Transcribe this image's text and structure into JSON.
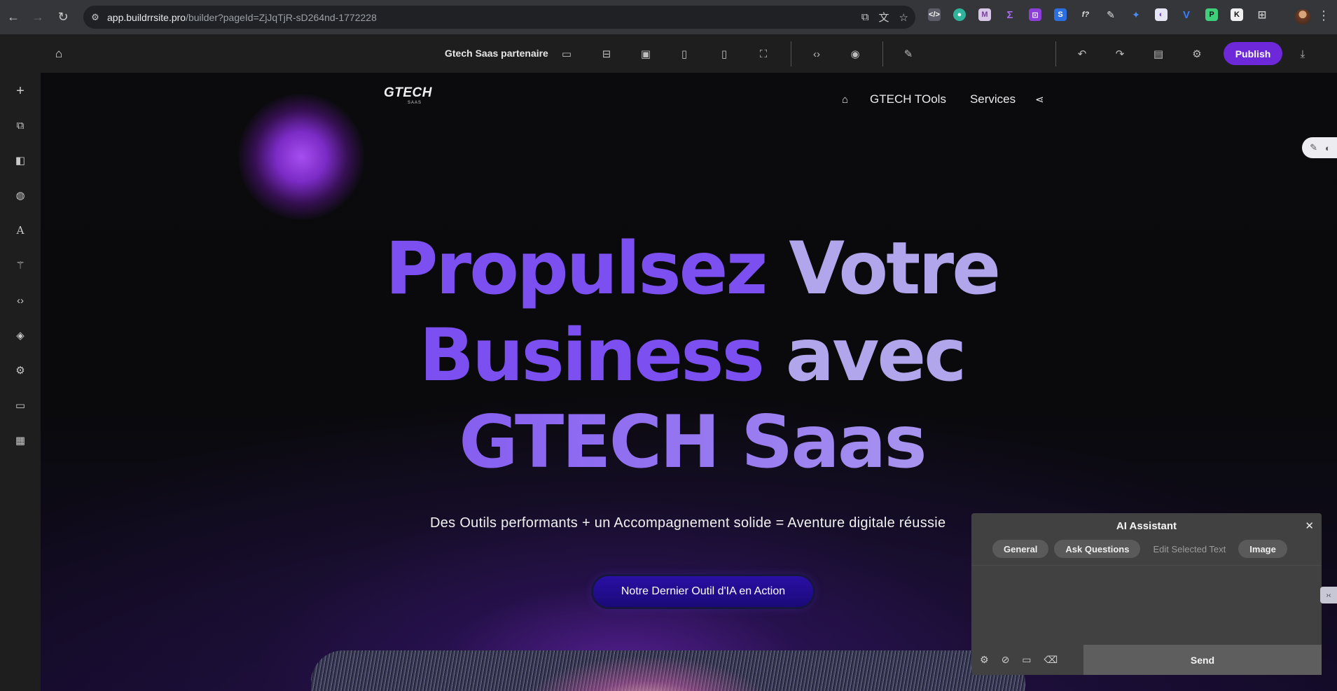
{
  "browser": {
    "url_host": "app.buildrrsite.pro",
    "url_path": "/builder?pageId=ZjJqTjR-sD264nd-1772228",
    "extensions": [
      "</>",
      "●",
      "M",
      "Σ",
      "⊡",
      "S",
      "f?",
      "✎",
      "✦",
      "◐",
      "V",
      "P",
      "K",
      "⊞"
    ]
  },
  "builder": {
    "page_name": "Gtech Saas partenaire",
    "publish_label": "Publish"
  },
  "site": {
    "logo_main": "GTECH",
    "logo_sub": "SAAS",
    "nav": [
      "GTECH TOols",
      "Services"
    ],
    "hero_line1_a": "Propulsez",
    "hero_line1_b": "Votre",
    "hero_line2_a": "Business",
    "hero_line2_b": "avec",
    "hero_line3": "GTECH Saas",
    "subtitle": "Des Outils performants + un Accompagnement solide = Aventure digitale réussie",
    "cta_label": "Notre Dernier Outil d'IA en Action"
  },
  "ai_assistant": {
    "title": "AI Assistant",
    "tabs": [
      "General",
      "Ask Questions",
      "Edit Selected Text",
      "Image"
    ],
    "send_label": "Send"
  },
  "colors": {
    "accent": "#6d28d9",
    "hero_purple": "#7c4ff0",
    "hero_lilac": "#b1a6ec"
  }
}
